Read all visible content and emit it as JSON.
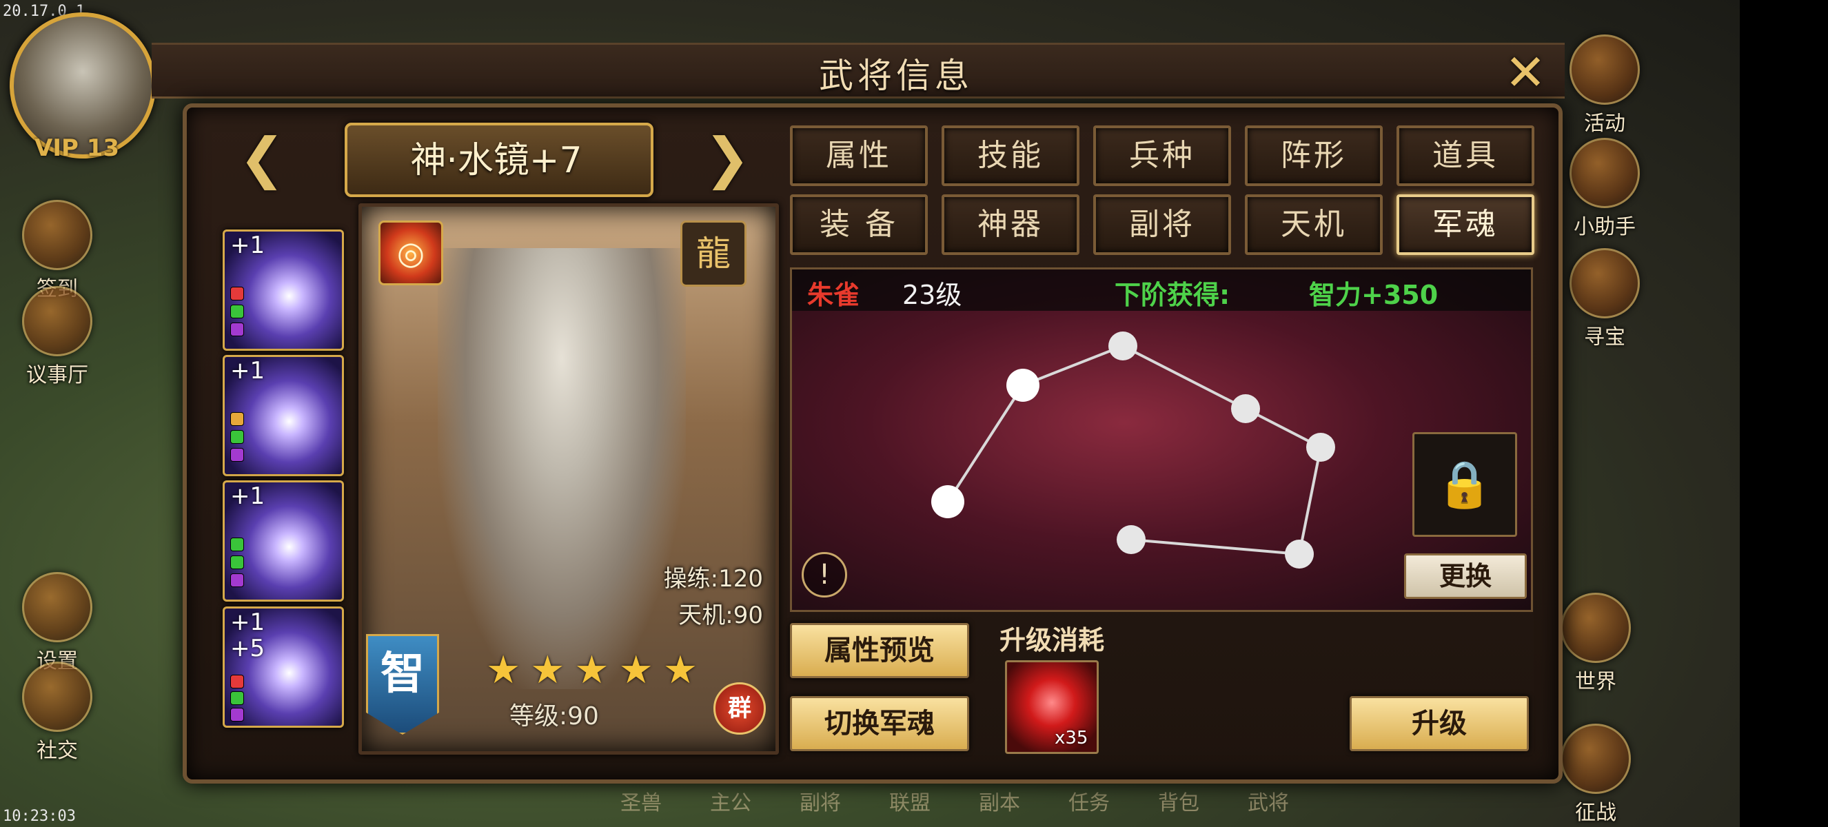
{
  "debug": {
    "version": "20.17.0.1",
    "clock": "10:23:03"
  },
  "player": {
    "vip": "VIP 13"
  },
  "left_menu": [
    {
      "label": "签到",
      "icon": "sign-in-icon"
    },
    {
      "label": "议事厅",
      "icon": "council-hall-icon"
    },
    {
      "label": "设置",
      "icon": "gear-icon"
    },
    {
      "label": "社交",
      "icon": "social-icon"
    }
  ],
  "right_menu": [
    {
      "label": "活动",
      "icon": "gift-icon"
    },
    {
      "label": "小助手",
      "icon": "scroll-icon"
    },
    {
      "label": "寻宝",
      "icon": "treasure-chest-icon"
    },
    {
      "label": "世界",
      "icon": "world-icon"
    },
    {
      "label": "征战",
      "icon": "battle-icon"
    }
  ],
  "bottom_nav": [
    "圣兽",
    "主公",
    "副将",
    "联盟",
    "副本",
    "任务",
    "背包",
    "武将"
  ],
  "modal": {
    "title": "武将信息",
    "close_icon": "close-icon"
  },
  "hero": {
    "name": "神·水镜+7",
    "stat_training_label": "操练:",
    "stat_training_value": "120",
    "stat_tianji_label": "天机:",
    "stat_tianji_value": "90",
    "type_badge": "智",
    "stars": 5,
    "level_label": "等级:",
    "level_value": "90",
    "faction": "群",
    "element_glyph": "◎",
    "dragon_glyph": "龍"
  },
  "soul_cards": [
    {
      "plus": "+1",
      "extra": "",
      "gems": [
        "#e53a3a",
        "#3ac43a",
        "#a33ad0"
      ]
    },
    {
      "plus": "+1",
      "extra": "",
      "gems": [
        "#e6a73a",
        "#3ac43a",
        "#a33ad0"
      ]
    },
    {
      "plus": "+1",
      "extra": "",
      "gems": [
        "#3ac43a",
        "#3ac43a",
        "#a33ad0"
      ]
    },
    {
      "plus": "+1",
      "extra": "+5",
      "gems": [
        "#e53a3a",
        "#3ac43a",
        "#a33ad0"
      ]
    }
  ],
  "tabs": [
    {
      "label": "属性",
      "active": false
    },
    {
      "label": "技能",
      "active": false
    },
    {
      "label": "兵种",
      "active": false
    },
    {
      "label": "阵形",
      "active": false
    },
    {
      "label": "道具",
      "active": false
    },
    {
      "label": "装 备",
      "active": false
    },
    {
      "label": "神器",
      "active": false
    },
    {
      "label": "副将",
      "active": false
    },
    {
      "label": "天机",
      "active": false
    },
    {
      "label": "军魂",
      "active": true
    }
  ],
  "army_soul": {
    "name": "朱雀",
    "level": "23级",
    "next_gain_label": "下阶获得:",
    "next_gain_value": "智力+350",
    "info_glyph": "!",
    "lock_glyph": "🔒",
    "swap_label": "更换"
  },
  "buttons": {
    "preview_label": "属性预览",
    "switch_label": "切换军魂",
    "upgrade_label": "升级"
  },
  "upgrade_cost": {
    "label": "升级消耗",
    "item_qty": "x35"
  },
  "colors": {
    "soul_name": "#e83a2c",
    "next_gain": "#4ed24a",
    "gold": "#d6a94a",
    "star": "#f6c43a"
  }
}
